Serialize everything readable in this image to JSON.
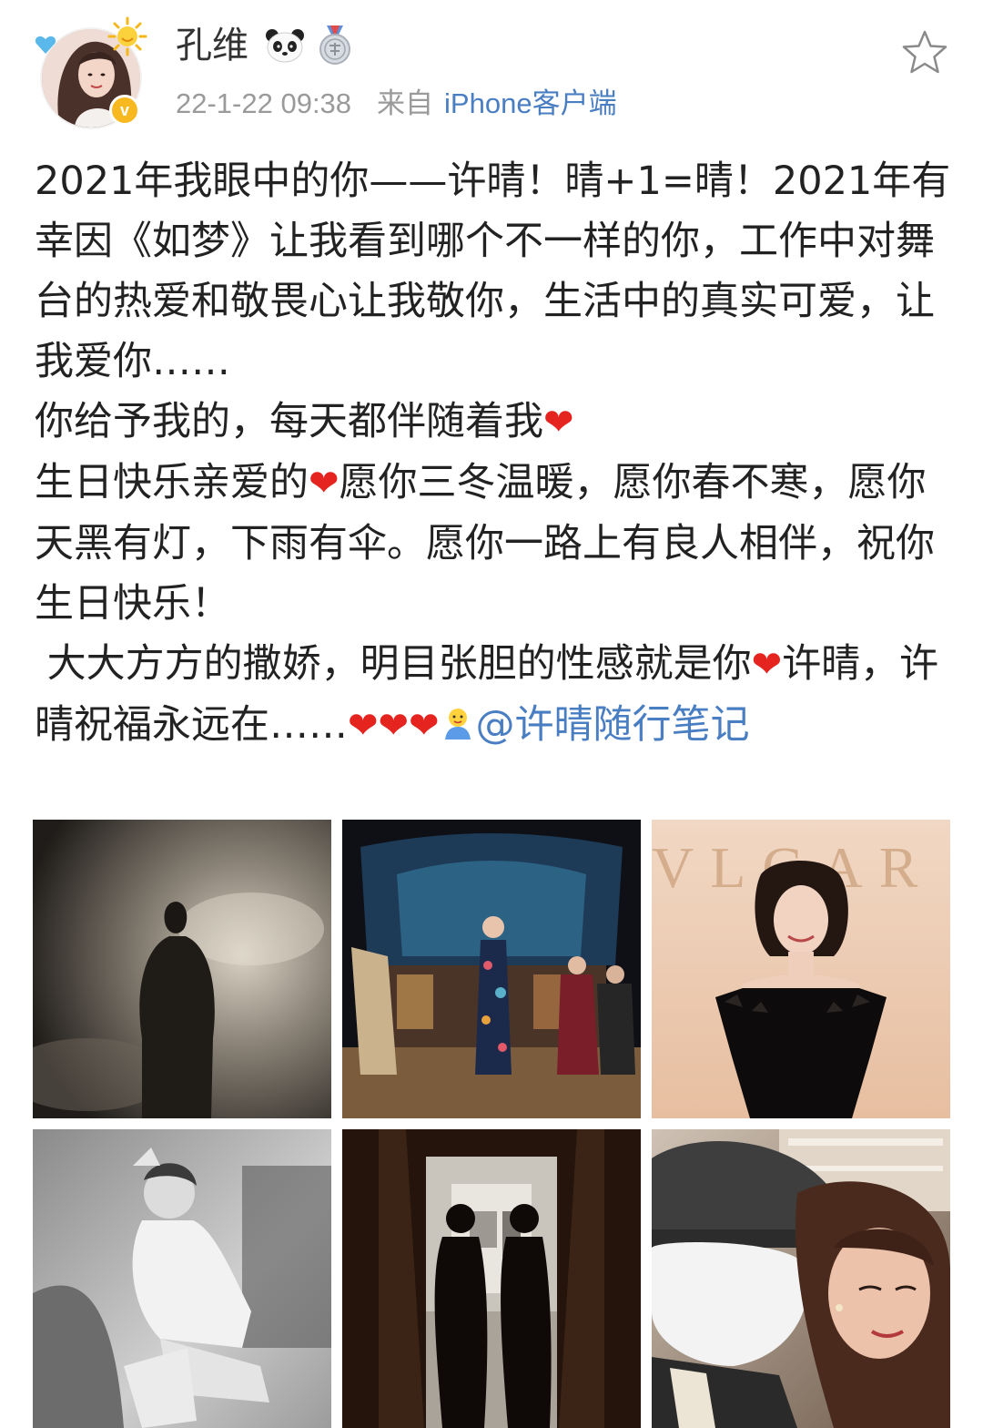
{
  "user": {
    "name": "孔维",
    "badges": [
      "panda-icon",
      "medal-icon"
    ],
    "verified_label": "v"
  },
  "meta": {
    "time": "22-1-22 09:38",
    "source_prefix": "来自",
    "source_client": "iPhone客户端"
  },
  "post": {
    "paragraph_1": "2021年我眼中的你——许晴！晴+1=晴！2021年有幸因《如梦》让我看到哪个不一样的你，工作中对舞台的热爱和敬畏心让我敬你，生活中的真实可爱，让我爱你……",
    "paragraph_2": "你给予我的，每天都伴随着我",
    "paragraph_3a": "生日快乐亲爱的",
    "paragraph_3b": "愿你三冬温暖，愿你春不寒，愿你天黑有灯，下雨有伞。愿你一路上有良人相伴，祝你生日快乐！",
    "paragraph_4a": " 大大方方的撒娇，明目张胆的性感就是你",
    "paragraph_4b": "许晴，许晴祝福永远在……",
    "heart": "❤",
    "mention": "@许晴随行笔记"
  },
  "photos": {
    "count": 6,
    "photo_3_logo_text": "VLGAR"
  },
  "colors": {
    "link": "#4a7ec2",
    "meta": "#9a9a9a",
    "heart": "#e5231f",
    "verified": "#f7b91f"
  }
}
